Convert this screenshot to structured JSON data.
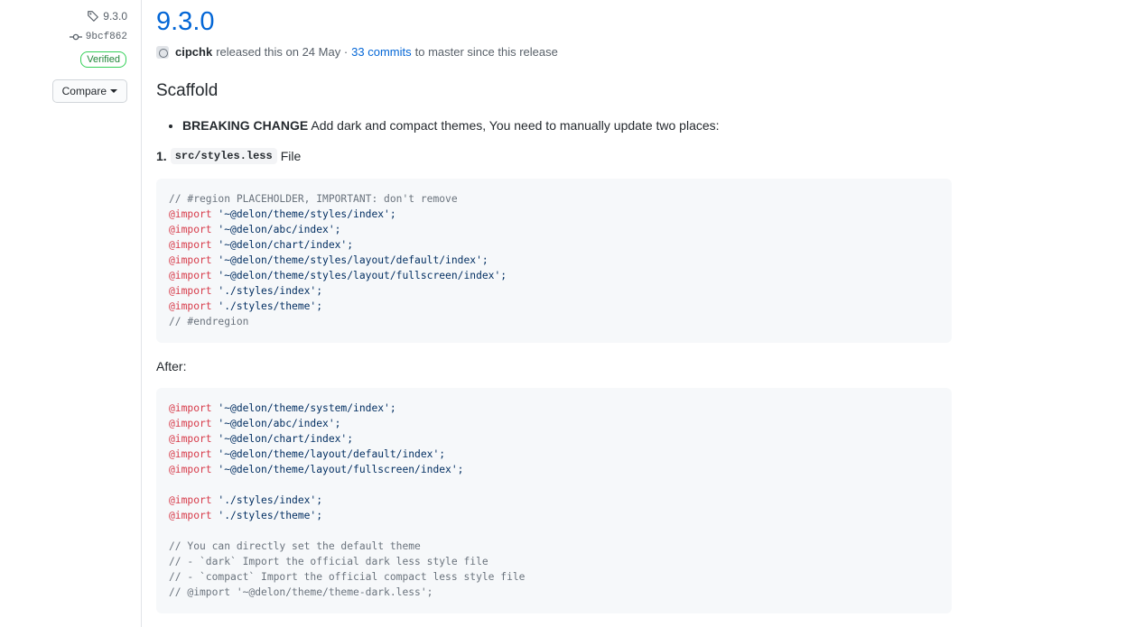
{
  "sidebar": {
    "tag": "9.3.0",
    "commit": "9bcf862",
    "verified": "Verified",
    "compare_label": "Compare"
  },
  "release": {
    "title": "9.3.0",
    "author": "cipchk",
    "released_text": "released this on 24 May ·",
    "commits_link": "33 commits",
    "since_text": "to master since this release"
  },
  "section": {
    "title": "Scaffold",
    "bullet_bold": "BREAKING CHANGE",
    "bullet_text": " Add dark and compact themes, You need to manually update two places:",
    "step_number": "1.",
    "step_code": "src/styles.less",
    "step_text": "File",
    "after_label": "After:"
  },
  "code_before": [
    {
      "type": "comment",
      "text": "// #region PLACEHOLDER, IMPORTANT: don't remove"
    },
    {
      "type": "import",
      "kw": "@import",
      "str": " '~@delon/theme/styles/index';"
    },
    {
      "type": "import",
      "kw": "@import",
      "str": " '~@delon/abc/index';"
    },
    {
      "type": "import",
      "kw": "@import",
      "str": " '~@delon/chart/index';"
    },
    {
      "type": "import",
      "kw": "@import",
      "str": " '~@delon/theme/styles/layout/default/index';"
    },
    {
      "type": "import",
      "kw": "@import",
      "str": " '~@delon/theme/styles/layout/fullscreen/index';"
    },
    {
      "type": "import",
      "kw": "@import",
      "str": " './styles/index';"
    },
    {
      "type": "import",
      "kw": "@import",
      "str": " './styles/theme';"
    },
    {
      "type": "comment",
      "text": "// #endregion"
    }
  ],
  "code_after": [
    {
      "type": "import",
      "kw": "@import",
      "str": " '~@delon/theme/system/index';"
    },
    {
      "type": "import",
      "kw": "@import",
      "str": " '~@delon/abc/index';"
    },
    {
      "type": "import",
      "kw": "@import",
      "str": " '~@delon/chart/index';"
    },
    {
      "type": "import",
      "kw": "@import",
      "str": " '~@delon/theme/layout/default/index';"
    },
    {
      "type": "import",
      "kw": "@import",
      "str": " '~@delon/theme/layout/fullscreen/index';"
    },
    {
      "type": "blank",
      "text": ""
    },
    {
      "type": "import",
      "kw": "@import",
      "str": " './styles/index';"
    },
    {
      "type": "import",
      "kw": "@import",
      "str": " './styles/theme';"
    },
    {
      "type": "blank",
      "text": ""
    },
    {
      "type": "comment",
      "text": "// You can directly set the default theme"
    },
    {
      "type": "comment",
      "text": "// - `dark` Import the official dark less style file"
    },
    {
      "type": "comment",
      "text": "// - `compact` Import the official compact less style file"
    },
    {
      "type": "comment",
      "text": "// @import '~@delon/theme/theme-dark.less';"
    }
  ]
}
